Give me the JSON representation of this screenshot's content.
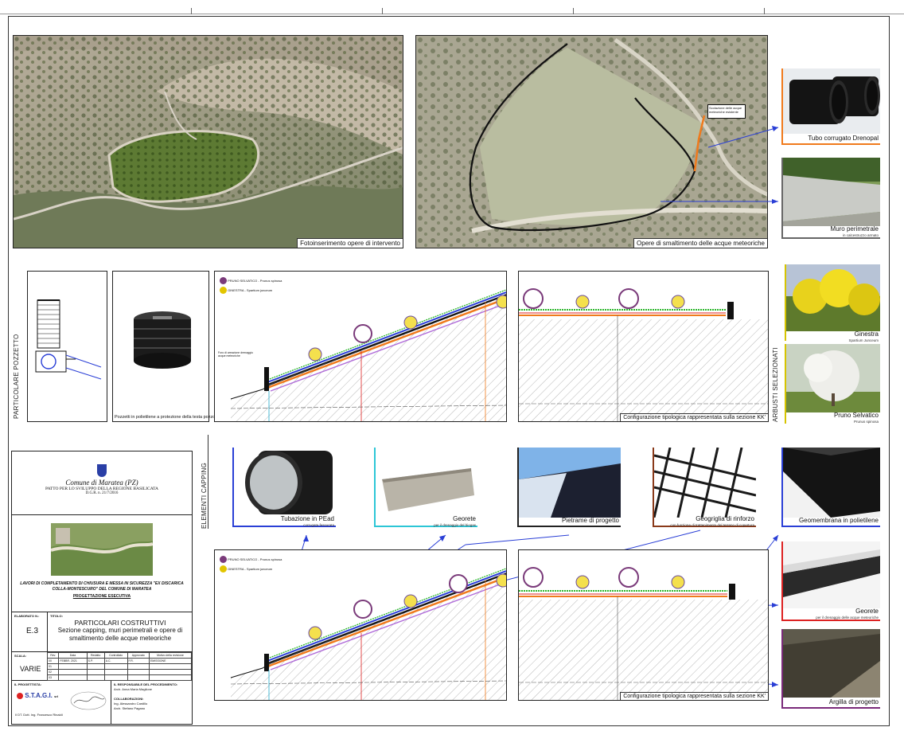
{
  "photos": {
    "photo1_caption": "Fotoinserimento opere di intervento",
    "photo2_caption": "Opere di smaltimento delle acque meteoriche",
    "photo2_annotation": "Scolazione delle acque meteoriche esistente"
  },
  "right_top": {
    "pipe_label": "Tubo corrugato Drenopal",
    "wall_label": "Muro perimetrale",
    "wall_sub": "in calcestruzzo armato"
  },
  "pozzetto": {
    "section_label": "PARTICOLARE POZZETTO",
    "caption": "Pozzetti in polietilene a protezione della testa pozzo"
  },
  "legend": {
    "pruno": "PRUNO SELVATICO - Prunus spinosa",
    "ginestra": "GINESTRA - Spartium junceum"
  },
  "sections": {
    "small_note": "Foro di areazione drenaggio acque meteoriche",
    "config_caption": "Configurazione tipologica rappresentata sulla sezione KK'"
  },
  "arbusti": {
    "section_label": "ARBUSTI SELEZIONATI",
    "ginestra": "Ginestra",
    "ginestra_sub": "Spartium Junceum",
    "pruno": "Pruno Selvatico",
    "pruno_sub": "Prunus spinosa"
  },
  "capping": {
    "section_label": "ELEMENTI CAPPING",
    "tubazione": "Tubazione in PEad",
    "tubazione_sub": "corrugata fessurata",
    "georete": "Georete",
    "georete_sub": "per il drenaggio del biogas",
    "pietrame": "Pietrame di progetto",
    "geogriglia": "Geogriglia di rinforzo",
    "geogriglia_sub": "con funzione di trattenimento del terreno di copertura",
    "geomembrana": "Geomembrana in polietilene",
    "georete2": "Georete",
    "georete2_sub": "per il drenaggio delle acque meteoriche",
    "argilla": "Argilla di progetto"
  },
  "title_block": {
    "comune": "Comune di Maratea (PZ)",
    "patto": "PATTO PER LO SVILUPPO DELLA REGIONE BASILICATA",
    "dgr": "D.G.R. n. 21/7/2016",
    "lavori": "LAVORI DI COMPLETAMENTO DI CHIUSURA E MESSA IN SICUREZZA \"EX DISCARICA COLLA-MONTESCURO\" DEL COMUNE DI MARATEA",
    "progetto": "PROGETTAZIONE ESECUTIVA",
    "elaborato_label": "ELABORATO N.:",
    "titolo_label": "TITOLO:",
    "elaborato": "E.3",
    "titolo_main": "PARTICOLARI COSTRUTTIVI",
    "titolo_sub": "Sezione capping, muri perimetrali e opere di smaltimento delle acque meteoriche",
    "scala_label": "SCALA:",
    "scala": "VARIE",
    "rev_headers": [
      "Rev.",
      "Data",
      "Redatto",
      "Controllato",
      "Approvato",
      "Motivo della revisione"
    ],
    "rev_rows": [
      [
        "00",
        "FEBBR. 2021",
        "S.P.",
        "A.C.",
        "F.R.",
        "EMISSIONE"
      ],
      [
        "01",
        "",
        "",
        "",
        "",
        ""
      ],
      [
        "02",
        "",
        "",
        "",
        "",
        ""
      ],
      [
        "03",
        "",
        "",
        "",
        "",
        ""
      ]
    ],
    "progettista_label": "IL PROGETTISTA:",
    "stagi": "S.T.A.G.I.",
    "stagi_suffix": "srl",
    "progettista_name": "Il DT. Dott. Ing. Francesco Rinaldi",
    "resp_label": "IL RESPONSABILE DEL PROCEDIMENTO:",
    "resp_name": "Arch. Anna Maria Maglione",
    "collab_label": "COLLABORAZIONI:",
    "collab1": "Ing. Alessandro Cardillo",
    "collab2": "Arch. Stefano Pagano"
  }
}
